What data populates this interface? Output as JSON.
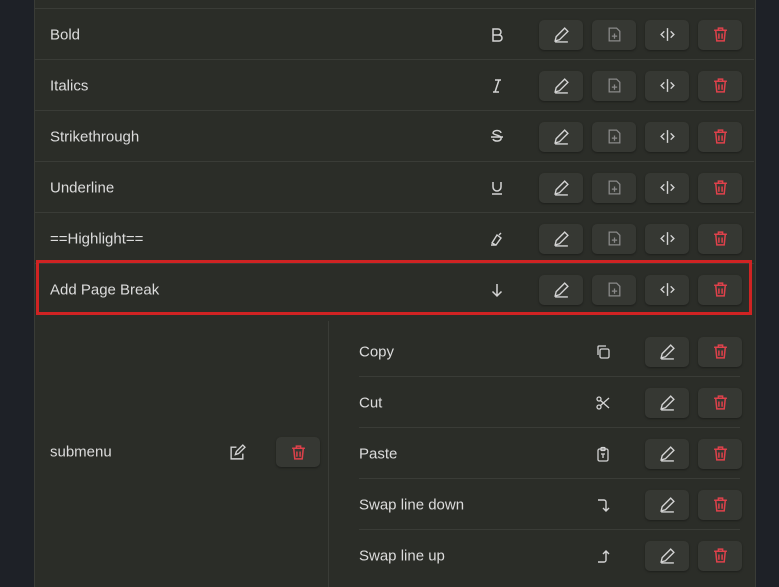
{
  "colors": {
    "background": "#1e2127",
    "panel": "#2b2d28",
    "button": "#363833",
    "delete": "#e0414b",
    "highlight_border": "#d02323",
    "text": "#dcdcdc"
  },
  "commands": [
    {
      "label": "Bold",
      "icon": "bold-icon"
    },
    {
      "label": "Italics",
      "icon": "italic-icon"
    },
    {
      "label": "Strikethrough",
      "icon": "strikethrough-icon"
    },
    {
      "label": "Underline",
      "icon": "underline-icon"
    },
    {
      "label": "==Highlight==",
      "icon": "highlighter-icon"
    },
    {
      "label": "Add Page Break",
      "icon": "arrow-down-icon",
      "highlighted": true
    }
  ],
  "submenu": {
    "label": "submenu",
    "items": [
      {
        "label": "Copy",
        "icon": "copy-icon"
      },
      {
        "label": "Cut",
        "icon": "scissors-icon"
      },
      {
        "label": "Paste",
        "icon": "clipboard-icon"
      },
      {
        "label": "Swap line down",
        "icon": "corner-down-right-icon"
      },
      {
        "label": "Swap line up",
        "icon": "corner-up-right-icon"
      }
    ]
  }
}
